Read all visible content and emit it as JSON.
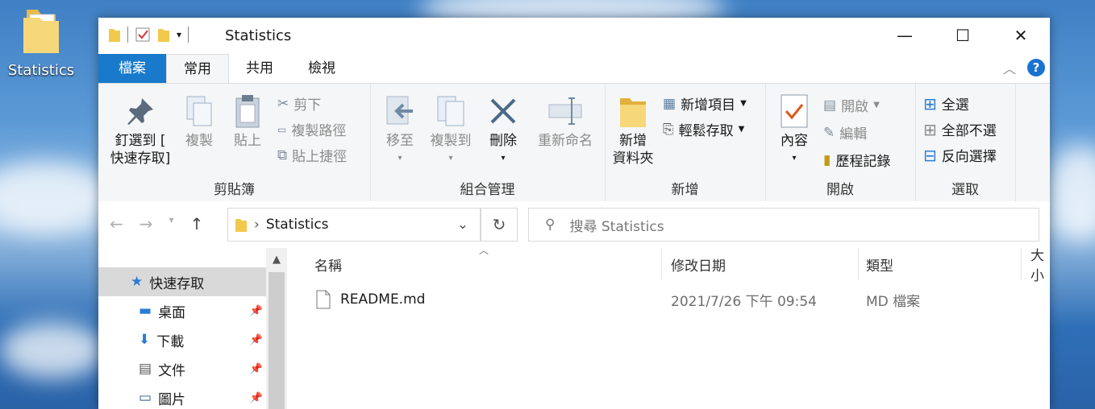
{
  "desktop": {
    "icon_label": "Statistics"
  },
  "window": {
    "title": "Statistics",
    "controls": {
      "minimize": "—",
      "maximize": "☐",
      "close": "✕"
    }
  },
  "ribbon_tabs": {
    "file": "檔案",
    "home": "常用",
    "share": "共用",
    "view": "檢視"
  },
  "clipboard": {
    "pin_line1": "釘選到 [",
    "pin_line2": "快速存取]",
    "copy": "複製",
    "paste": "貼上",
    "cut": "剪下",
    "copy_path": "複製路徑",
    "paste_shortcut": "貼上捷徑",
    "group": "剪貼簿"
  },
  "organize": {
    "move_to": "移至",
    "copy_to": "複製到",
    "delete": "刪除",
    "rename": "重新命名",
    "group": "組合管理"
  },
  "new": {
    "new_folder_line1": "新增",
    "new_folder_line2": "資料夾",
    "new_item": "新增項目",
    "easy_access": "輕鬆存取",
    "group": "新增"
  },
  "open": {
    "properties": "內容",
    "open": "開啟",
    "edit": "編輯",
    "history": "歷程記錄",
    "group": "開啟"
  },
  "select": {
    "select_all": "全選",
    "select_none": "全部不選",
    "invert": "反向選擇",
    "group": "選取"
  },
  "address": {
    "crumb": "Statistics"
  },
  "search": {
    "placeholder": "搜尋 Statistics"
  },
  "nav": {
    "quick_access": "快速存取",
    "items": [
      {
        "label": "桌面"
      },
      {
        "label": "下載"
      },
      {
        "label": "文件"
      },
      {
        "label": "圖片"
      }
    ]
  },
  "columns": {
    "name": "名稱",
    "date": "修改日期",
    "type": "類型",
    "size": "大小"
  },
  "files": [
    {
      "name": "README.md",
      "date": "2021/7/26 下午 09:54",
      "type": "MD 檔案"
    }
  ]
}
